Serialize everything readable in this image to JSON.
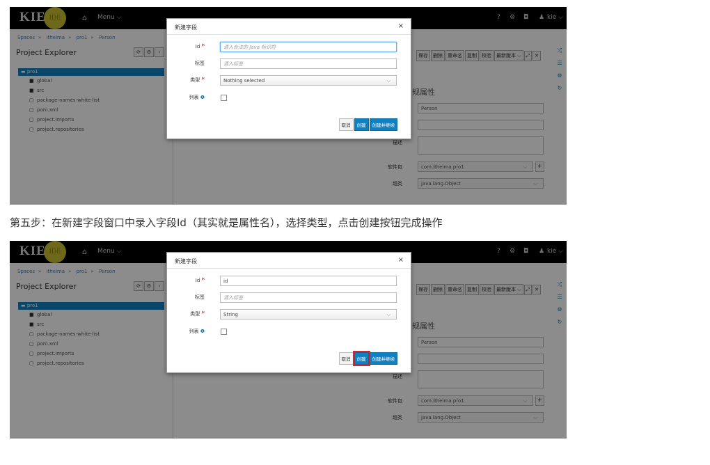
{
  "shots": [
    {
      "app": {
        "logo": "KIE",
        "ide": "IDE",
        "menu": "Menu ⌵",
        "help": "?",
        "user": "kie ⌵"
      },
      "breadcrumb": [
        "Spaces",
        "itheima",
        "pro1",
        "Person"
      ],
      "explorer": {
        "title": "Project Explorer",
        "root": "pro1",
        "items": [
          "global",
          "src",
          "package-names-white-list",
          "pom.xml",
          "project.imports",
          "project.repositories"
        ]
      },
      "toolbar": [
        "保存",
        "删除",
        "重命名",
        "复制",
        "校验",
        "最新版本 ⌵"
      ],
      "editor": {
        "section": "规属性",
        "name_value": "Person",
        "desc_label": "描述",
        "package_label": "软件包",
        "package_value": "com.itheima.pro1",
        "super_label": "超类",
        "super_value": "java.lang.Object"
      },
      "dialog": {
        "title": "新建字段",
        "close": "×",
        "id_label": "Id",
        "id_value": "",
        "id_placeholder": "请入合法的 Java 标识符",
        "label_label": "标签",
        "label_placeholder": "请入标签",
        "type_label": "类型",
        "type_value": "Nothing selected",
        "list_label": "列表",
        "cancel": "取消",
        "create": "创建",
        "create_continue": "创建并继续"
      }
    },
    {
      "app": {
        "logo": "KIE",
        "ide": "IDE",
        "menu": "Menu ⌵",
        "help": "?",
        "user": "kie ⌵"
      },
      "breadcrumb": [
        "Spaces",
        "itheima",
        "pro1",
        "Person"
      ],
      "explorer": {
        "title": "Project Explorer",
        "root": "pro1",
        "items": [
          "global",
          "src",
          "package-names-white-list",
          "pom.xml",
          "project.imports",
          "project.repositories"
        ]
      },
      "toolbar": [
        "保存",
        "删除",
        "重命名",
        "复制",
        "校验",
        "最新版本 ⌵"
      ],
      "editor": {
        "section": "规属性",
        "name_value": "Person",
        "desc_label": "描述",
        "package_label": "软件包",
        "package_value": "com.itheima.pro1",
        "super_label": "超类",
        "super_value": "java.lang.Object"
      },
      "dialog": {
        "title": "新建字段",
        "close": "×",
        "id_label": "Id",
        "id_value": "id",
        "id_placeholder": "",
        "label_label": "标签",
        "label_placeholder": "请入标签",
        "type_label": "类型",
        "type_value": "String",
        "list_label": "列表",
        "cancel": "取消",
        "create": "创建",
        "create_continue": "创建并继续"
      }
    }
  ],
  "caption": "第五步：在新建字段窗口中录入字段Id（其实就是属性名），选择类型，点击创建按钮完成操作",
  "colors": {
    "accent": "#0f80c1",
    "highlight": "#dd2222",
    "topbar": "#000000"
  }
}
